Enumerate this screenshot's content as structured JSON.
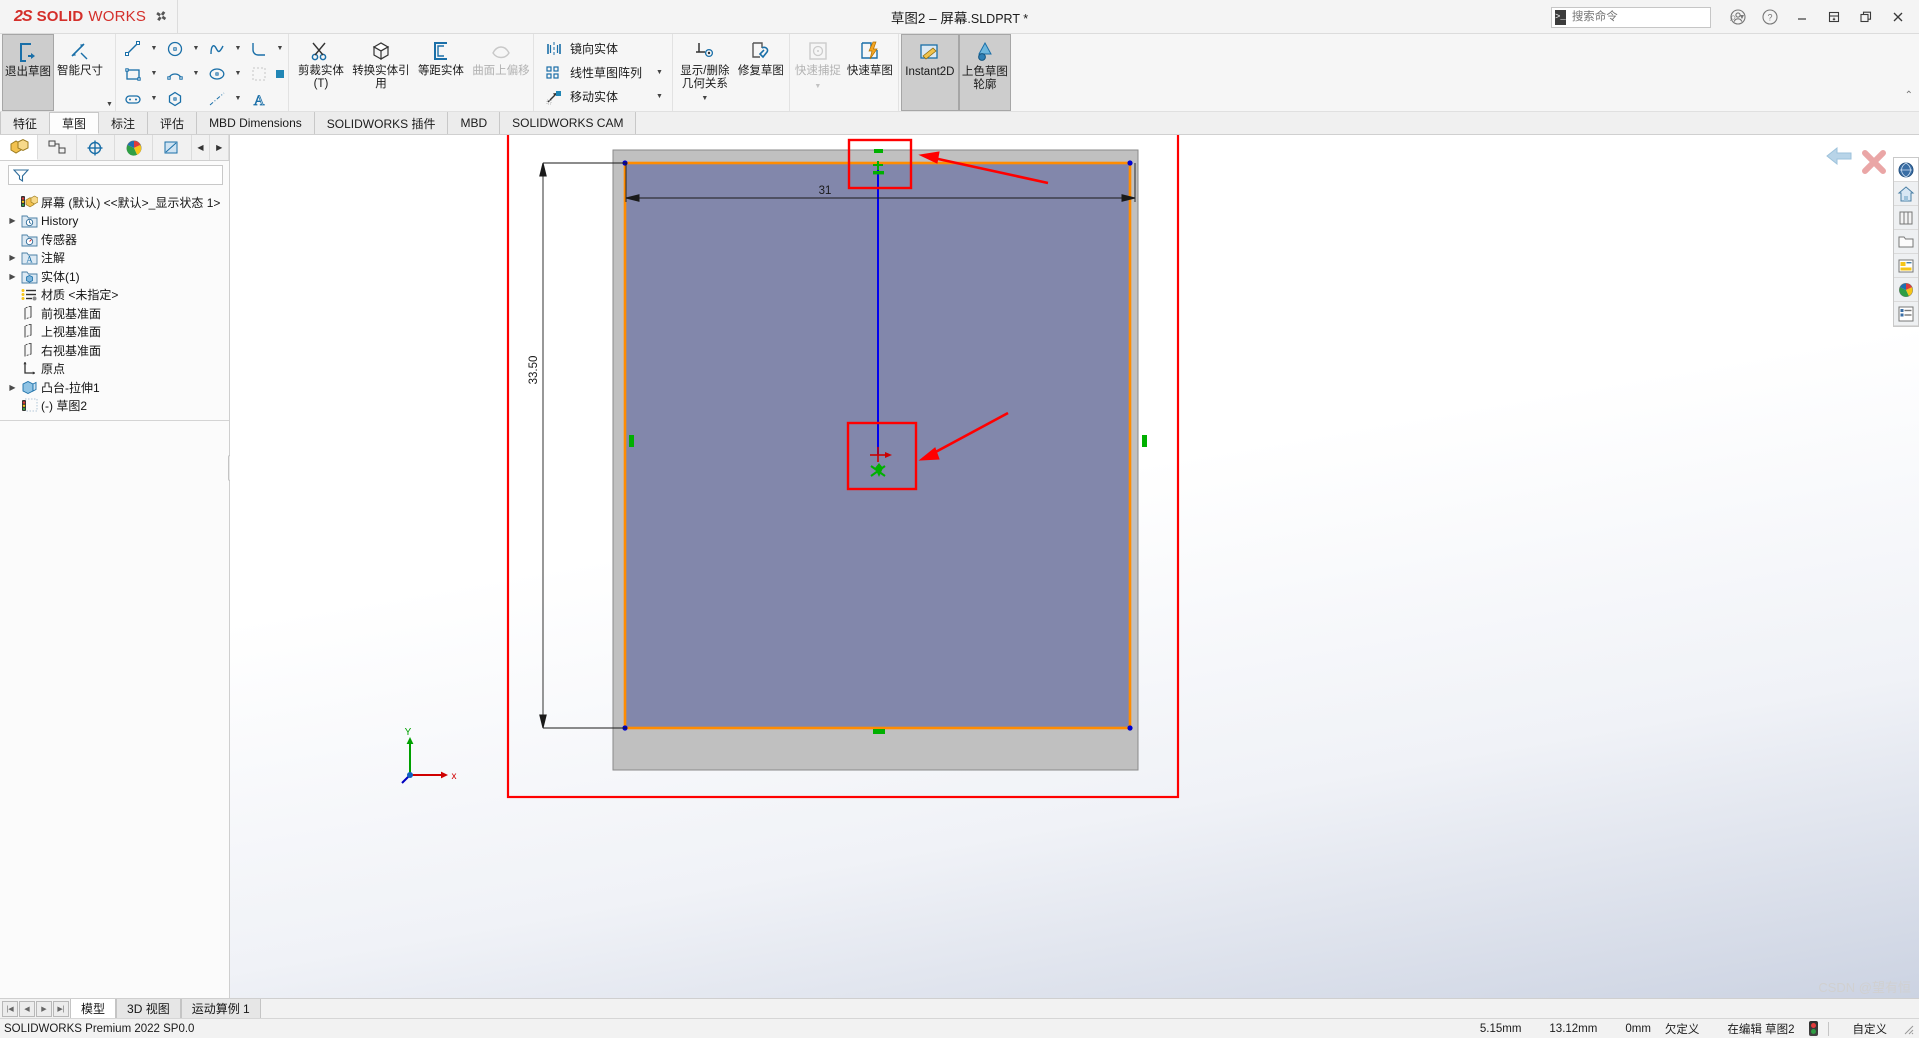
{
  "app": {
    "brand_ds": "2S",
    "brand_solid": "SOLID",
    "brand_works": "WORKS",
    "pin_icon": "pin-icon",
    "document_title_cn": "草图2 – 屏幕",
    "document_title_ext": ".SLDPRT *",
    "version_status": "SOLIDWORKS Premium 2022 SP0.0"
  },
  "search": {
    "placeholder": "搜索命令",
    "value": "",
    "icon": "command-search-icon"
  },
  "titlebar_buttons": [
    {
      "name": "account-icon",
      "glyph": "◍"
    },
    {
      "name": "help-icon",
      "glyph": "?"
    },
    {
      "name": "minimize-button",
      "glyph": "—"
    },
    {
      "name": "restore-button",
      "glyph": "⊞"
    },
    {
      "name": "maximize-button",
      "glyph": "❐"
    },
    {
      "name": "close-button",
      "glyph": "✕"
    }
  ],
  "ribbon": {
    "group1": [
      {
        "label": "退出草图",
        "name": "exit-sketch-button",
        "active": true,
        "disabled": false
      },
      {
        "label": "智能尺寸",
        "name": "smart-dimension-button",
        "active": false,
        "disabled": false
      }
    ],
    "sketch_tools_note": "line/rect/circle/arc/spline/text palette",
    "group3": [
      {
        "label": "剪裁实体(T)",
        "name": "trim-entities-button",
        "disabled": false
      },
      {
        "label": "转换实体引用",
        "name": "convert-entities-button",
        "disabled": false
      },
      {
        "label": "等距实体",
        "name": "offset-entities-button",
        "disabled": false
      },
      {
        "label": "曲面上偏移",
        "name": "offset-on-surface-button",
        "disabled": true
      }
    ],
    "group4": [
      {
        "label": "镜向实体",
        "name": "mirror-entities-button",
        "dropdown": false
      },
      {
        "label": "线性草图阵列",
        "name": "linear-sketch-pattern-button",
        "dropdown": true
      },
      {
        "label": "移动实体",
        "name": "move-entities-button",
        "dropdown": true
      }
    ],
    "group5": [
      {
        "label": "显示/删除几何关系",
        "name": "display-delete-relations-button",
        "dropdown": true
      },
      {
        "label": "修复草图",
        "name": "repair-sketch-button",
        "dropdown": false
      }
    ],
    "group6": [
      {
        "label": "快速捕捉",
        "name": "quick-snaps-button",
        "disabled": true,
        "dropdown": true
      },
      {
        "label": "快速草图",
        "name": "rapid-sketch-button",
        "disabled": false
      }
    ],
    "group7": [
      {
        "label": "Instant2D",
        "name": "instant2d-button",
        "active": true
      },
      {
        "label": "上色草图轮廓",
        "name": "shaded-sketch-contours-button",
        "active": true
      }
    ]
  },
  "tabs": [
    {
      "label": "特征",
      "name": "tab-features",
      "active": false
    },
    {
      "label": "草图",
      "name": "tab-sketch",
      "active": true
    },
    {
      "label": "标注",
      "name": "tab-markup",
      "active": false
    },
    {
      "label": "评估",
      "name": "tab-evaluate",
      "active": false
    },
    {
      "label": "MBD Dimensions",
      "name": "tab-mbd-dimensions",
      "active": false
    },
    {
      "label": "SOLIDWORKS 插件",
      "name": "tab-solidworks-addins",
      "active": false
    },
    {
      "label": "MBD",
      "name": "tab-mbd",
      "active": false
    },
    {
      "label": "SOLIDWORKS CAM",
      "name": "tab-solidworks-cam",
      "active": false
    }
  ],
  "tree_tabs": [
    {
      "name": "feature-manager-tab",
      "icon": "feature-tree-icon",
      "active": true
    },
    {
      "name": "property-manager-tab",
      "icon": "property-manager-icon",
      "active": false
    },
    {
      "name": "configuration-manager-tab",
      "icon": "configuration-icon",
      "active": false
    },
    {
      "name": "display-manager-tab",
      "icon": "appearance-sphere-icon",
      "active": false
    },
    {
      "name": "dimxpert-manager-tab",
      "icon": "dimxpert-icon",
      "active": false
    }
  ],
  "tree_nav": {
    "prev": "◀",
    "next": "▶"
  },
  "filter": {
    "placeholder": "",
    "value": "",
    "icon": "filter-funnel-icon"
  },
  "tree": [
    {
      "label": "屏幕 (默认) <<默认>_显示状态 1>",
      "icon": "part-root-icon",
      "expand": "none",
      "indent": 0,
      "name": "tree-item-part-root"
    },
    {
      "label": "History",
      "icon": "history-icon",
      "expand": "collapsed",
      "indent": 1,
      "name": "tree-item-history"
    },
    {
      "label": "传感器",
      "icon": "sensors-icon",
      "expand": "none",
      "indent": 1,
      "name": "tree-item-sensors"
    },
    {
      "label": "注解",
      "icon": "annotations-icon",
      "expand": "collapsed",
      "indent": 1,
      "name": "tree-item-annotations"
    },
    {
      "label": "实体(1)",
      "icon": "solid-bodies-icon",
      "expand": "collapsed",
      "indent": 1,
      "name": "tree-item-solid-bodies"
    },
    {
      "label": "材质 <未指定>",
      "icon": "material-icon",
      "expand": "none",
      "indent": 1,
      "name": "tree-item-material"
    },
    {
      "label": "前视基准面",
      "icon": "plane-icon",
      "expand": "none",
      "indent": 1,
      "name": "tree-item-front-plane"
    },
    {
      "label": "上视基准面",
      "icon": "plane-icon",
      "expand": "none",
      "indent": 1,
      "name": "tree-item-top-plane"
    },
    {
      "label": "右视基准面",
      "icon": "plane-icon",
      "expand": "none",
      "indent": 1,
      "name": "tree-item-right-plane"
    },
    {
      "label": "原点",
      "icon": "origin-icon",
      "expand": "none",
      "indent": 1,
      "name": "tree-item-origin"
    },
    {
      "label": "凸台-拉伸1",
      "icon": "extrude-boss-icon",
      "expand": "collapsed",
      "indent": 1,
      "name": "tree-item-boss-extrude1"
    },
    {
      "label": "(-) 草图2",
      "icon": "sketch-icon",
      "expand": "none",
      "indent": 1,
      "name": "tree-item-sketch2"
    }
  ],
  "view_toolbar": [
    {
      "name": "zoom-to-fit-icon",
      "dropdown": false
    },
    {
      "name": "zoom-to-area-icon",
      "dropdown": false
    },
    {
      "name": "previous-view-icon",
      "dropdown": false
    },
    {
      "name": "section-view-icon",
      "dropdown": false
    },
    {
      "name": "view-orientation-icon",
      "dropdown": false
    },
    {
      "name": "display-style-icon",
      "dropdown": true
    },
    {
      "name": "hide-show-items-icon",
      "dropdown": true
    },
    {
      "name": "edit-appearance-icon",
      "dropdown": true
    },
    {
      "name": "apply-scene-icon",
      "dropdown": true
    },
    {
      "name": "view-settings-icon",
      "dropdown": true
    }
  ],
  "right_toolbar": [
    {
      "name": "solidworks-resources-icon",
      "selected": true
    },
    {
      "name": "design-library-home-icon",
      "selected": false
    },
    {
      "name": "file-explorer-icon",
      "selected": false
    },
    {
      "name": "open-folder-icon",
      "selected": false
    },
    {
      "name": "view-palette-icon",
      "selected": false
    },
    {
      "name": "appearances-scenes-icon",
      "selected": false
    },
    {
      "name": "custom-properties-icon",
      "selected": false
    }
  ],
  "canvas": {
    "sketch_confirm_back": "↰",
    "sketch_confirm_cancel": "✕",
    "dim_horizontal": "31",
    "dim_vertical": "33.50",
    "axis_x_label": "x",
    "axis_y_label": "Y",
    "annotation_boxes": [
      {
        "name": "highlight-box-top",
        "note": "red rectangle around upper midpoint relation"
      },
      {
        "name": "highlight-box-center",
        "note": "red rectangle around origin / centerpoint"
      },
      {
        "name": "highlight-border",
        "note": "large red border framing the model"
      }
    ],
    "arrows": [
      {
        "name": "callout-arrow-top"
      },
      {
        "name": "callout-arrow-center"
      }
    ],
    "colors": {
      "sketch_fill": "#8287ab",
      "selected_edge": "#ff8c00",
      "relation_green": "#00b000",
      "body_gray": "#c0c0c0",
      "annotation_red": "#ff0000",
      "construction_blue": "#0000ff"
    }
  },
  "bottom_tabs": [
    {
      "label": "模型",
      "name": "bottom-tab-model",
      "active": true
    },
    {
      "label": "3D 视图",
      "name": "bottom-tab-3d-views",
      "active": false
    },
    {
      "label": "运动算例 1",
      "name": "bottom-tab-motion-study-1",
      "active": false
    }
  ],
  "bottom_nav": [
    {
      "name": "first-tab-button",
      "glyph": "|◀"
    },
    {
      "name": "prev-tab-button",
      "glyph": "◀"
    },
    {
      "name": "next-tab-button",
      "glyph": "▶"
    },
    {
      "name": "last-tab-button",
      "glyph": "▶|"
    }
  ],
  "status": {
    "left": "SOLIDWORKS Premium 2022 SP0.0",
    "coord_x": "5.15mm",
    "coord_y": "13.12mm",
    "coord_z": "0mm",
    "state": "欠定义",
    "editing": "在编辑 草图2",
    "light_icon": "traffic-light-icon",
    "customize": "自定义",
    "watermark": "CSDN @望有恒"
  }
}
